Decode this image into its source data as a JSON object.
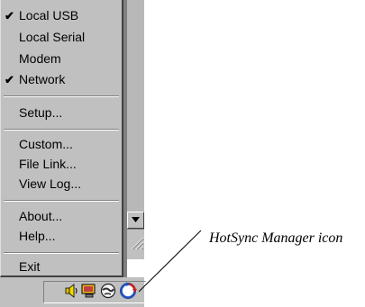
{
  "menu": {
    "items": [
      {
        "label": "Local USB",
        "checked": true
      },
      {
        "label": "Local Serial",
        "checked": false
      },
      {
        "label": "Modem",
        "checked": false
      },
      {
        "label": "Network",
        "checked": true
      },
      {
        "label": "Setup...",
        "checked": false
      },
      {
        "label": "Custom...",
        "checked": false
      },
      {
        "label": "File Link...",
        "checked": false
      },
      {
        "label": "View Log...",
        "checked": false
      },
      {
        "label": "About...",
        "checked": false
      },
      {
        "label": "Help...",
        "checked": false
      },
      {
        "label": "Exit",
        "checked": false
      }
    ],
    "check_glyph": "✔"
  },
  "tray": {
    "icons": [
      "speaker-icon",
      "monitor-icon",
      "globe-icon",
      "hotsync-icon"
    ]
  },
  "callout": {
    "label": "HotSync Manager icon"
  },
  "colors": {
    "menu_bg": "#c0c0c0",
    "hotsync_red": "#cc2020",
    "hotsync_blue": "#2050c0"
  }
}
